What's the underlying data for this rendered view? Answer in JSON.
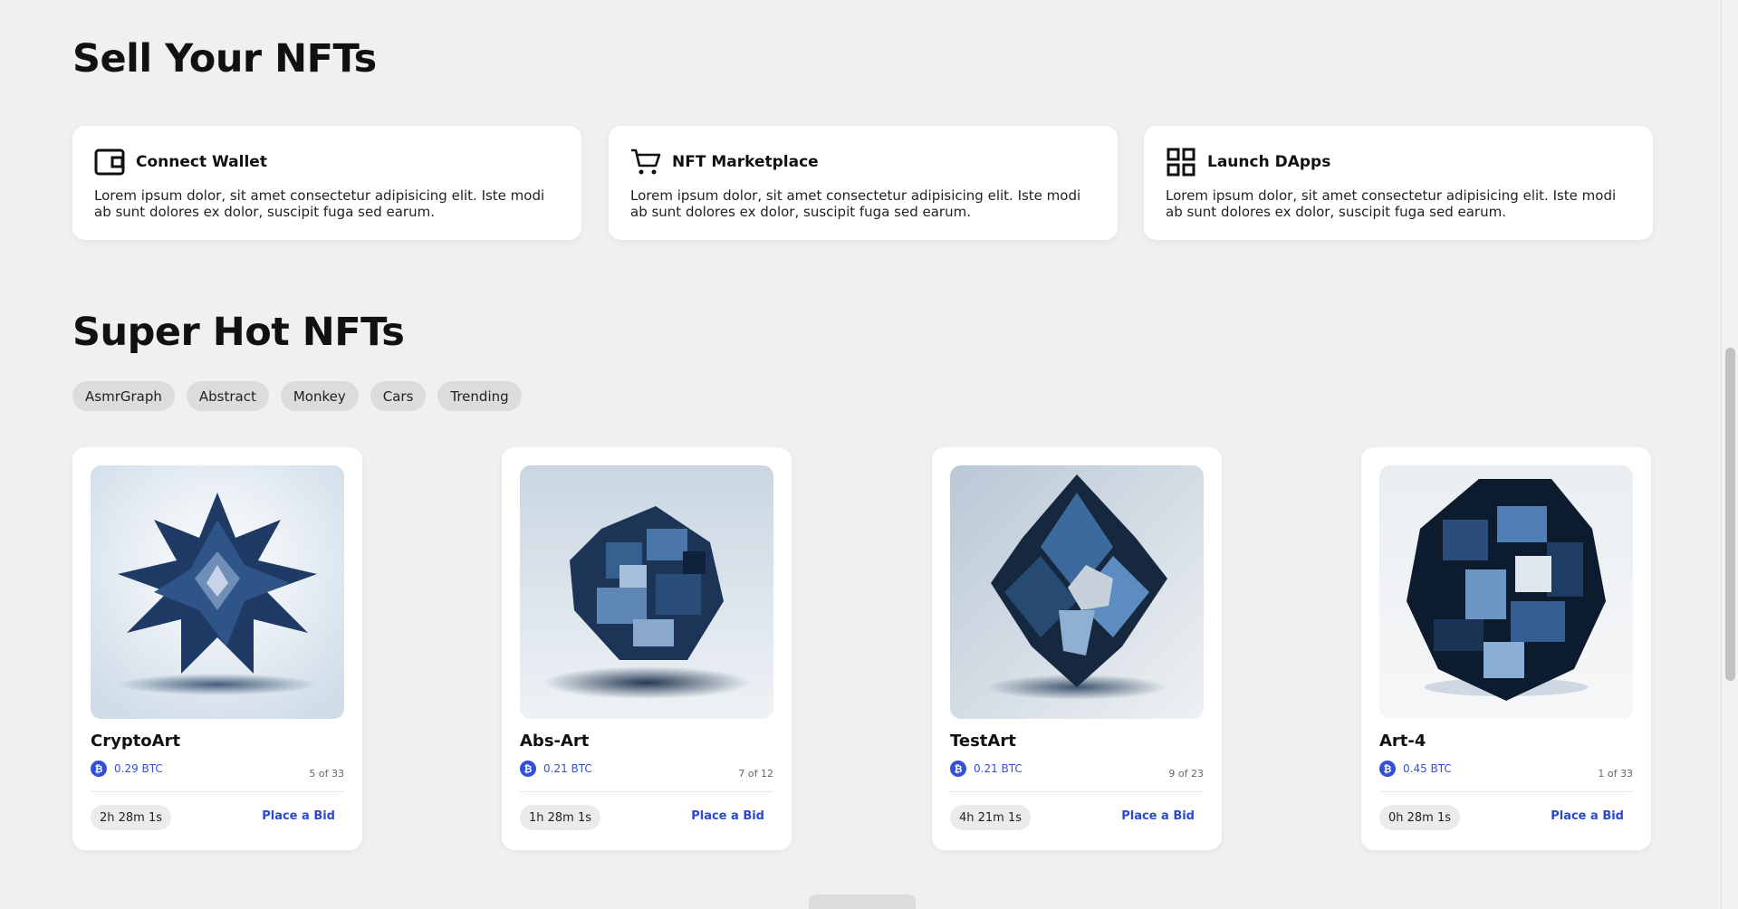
{
  "sell_section": {
    "title": "Sell Your NFTs",
    "features": [
      {
        "icon": "wallet-icon",
        "title": "Connect Wallet",
        "description": "Lorem ipsum dolor, sit amet consectetur adipisicing elit. Iste modi ab sunt dolores ex dolor, suscipit fuga sed earum."
      },
      {
        "icon": "cart-icon",
        "title": "NFT Marketplace",
        "description": "Lorem ipsum dolor, sit amet consectetur adipisicing elit. Iste modi ab sunt dolores ex dolor, suscipit fuga sed earum."
      },
      {
        "icon": "grid-icon",
        "title": "Launch DApps",
        "description": "Lorem ipsum dolor, sit amet consectetur adipisicing elit. Iste modi ab sunt dolores ex dolor, suscipit fuga sed earum."
      }
    ]
  },
  "hot_section": {
    "title": "Super Hot NFTs",
    "filters": [
      "AsmrGraph",
      "Abstract",
      "Monkey",
      "Cars",
      "Trending"
    ],
    "cards": [
      {
        "title": "CryptoArt",
        "price": "0.29 BTC",
        "edition": "5 of 33",
        "timer": "2h 28m 1s",
        "bid_label": "Place a Bid"
      },
      {
        "title": "Abs-Art",
        "price": "0.21 BTC",
        "edition": "7 of 12",
        "timer": "1h 28m 1s",
        "bid_label": "Place a Bid"
      },
      {
        "title": "TestArt",
        "price": "0.21 BTC",
        "edition": "9 of 23",
        "timer": "4h 21m 1s",
        "bid_label": "Place a Bid"
      },
      {
        "title": "Art-4",
        "price": "0.45 BTC",
        "edition": "1 of 33",
        "timer": "0h 28m 1s",
        "bid_label": "Place a Bid"
      }
    ]
  },
  "colors": {
    "background": "#f0f0f0",
    "accent": "#2a48d0",
    "card": "#ffffff"
  }
}
